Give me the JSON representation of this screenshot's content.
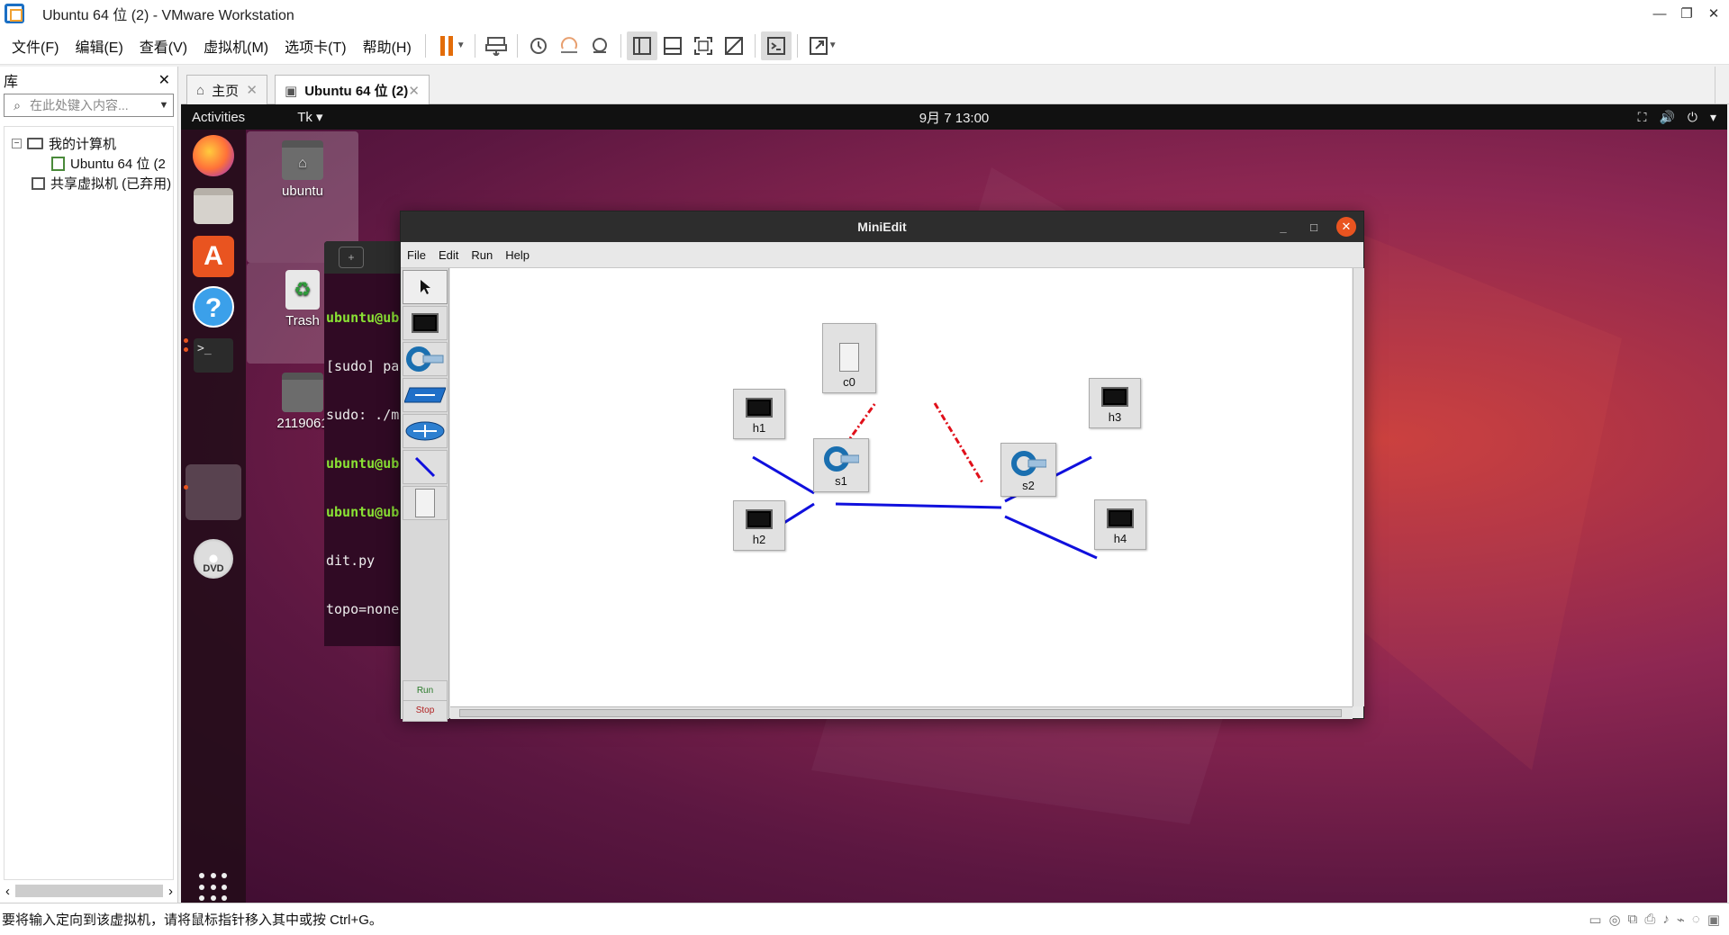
{
  "window": {
    "title": "Ubuntu 64 位 (2) - VMware Workstation",
    "min_glyph": "—",
    "max_glyph": "❐",
    "close_glyph": "✕"
  },
  "menu": [
    "文件(F)",
    "编辑(E)",
    "查看(V)",
    "虚拟机(M)",
    "选项卡(T)",
    "帮助(H)"
  ],
  "toolbar_icons": [
    "pause-icon",
    "send-ctrl-alt-del-icon",
    "snapshot-icon",
    "revert-snapshot-icon",
    "snapshot-manager-icon",
    "library-view-icon",
    "thumbnail-view-icon",
    "full-screen-icon",
    "unity-icon",
    "console-icon",
    "stretch-icon"
  ],
  "library": {
    "title": "库",
    "close": "✕",
    "search_placeholder": "在此处键入内容...",
    "tree": {
      "my_computer": "我的计算机",
      "vm": "Ubuntu 64 位 (2",
      "shared": "共享虚拟机 (已弃用)"
    }
  },
  "tabs": {
    "home": "主页",
    "vm": "Ubuntu 64 位 (2)",
    "close": "✕"
  },
  "status": {
    "text": "要将输入定向到该虚拟机，请将鼠标指针移入其中或按 Ctrl+G。"
  },
  "guest": {
    "activities": "Activities",
    "app_menu": "Tk ▾",
    "clock": "9月 7  13:00",
    "tray": [
      "⛶",
      "🔊",
      "⏻",
      "▾"
    ],
    "desktop": {
      "home_label": "ubuntu",
      "trash_label": "Trash",
      "folder_label": "2119061"
    },
    "dock_dvd": "DVD",
    "terminal": {
      "newtab": "+",
      "lines": [
        {
          "text": "ubuntu@ub",
          "green": true
        },
        {
          "text": "[sudo] pa",
          "green": false
        },
        {
          "text": "sudo: ./m",
          "green": false
        },
        {
          "text": "ubuntu@ub",
          "green": true
        },
        {
          "text": "ubuntu@ub",
          "green": true
        },
        {
          "text": "dit.py",
          "green": false
        },
        {
          "text": "topo=none",
          "green": false
        }
      ]
    }
  },
  "miniedit": {
    "title": "MiniEdit",
    "menus": [
      "File",
      "Edit",
      "Run",
      "Help"
    ],
    "controls": {
      "min": "_",
      "max": "□",
      "close": "✕"
    },
    "run_label": "Run",
    "stop_label": "Stop",
    "nodes": {
      "c0": "c0",
      "s1": "s1",
      "s2": "s2",
      "h1": "h1",
      "h2": "h2",
      "h3": "h3",
      "h4": "h4"
    },
    "link_color": "#1010dd",
    "controller_link_color": "#e0101a"
  }
}
